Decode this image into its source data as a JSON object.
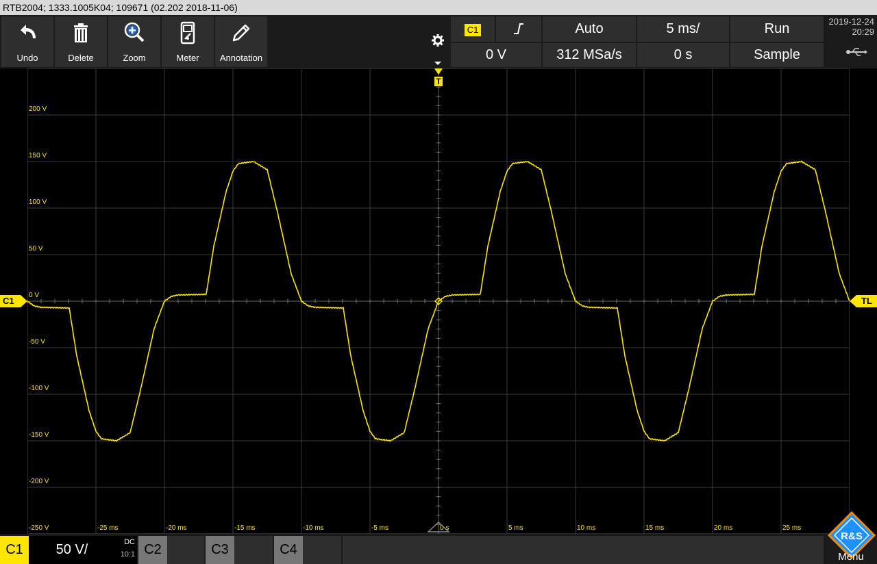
{
  "title_bar": "RTB2004; 1333.1005K04; 109671 (02.202 2018-11-06)",
  "toolbar": {
    "items": [
      {
        "label": "Undo",
        "icon": "undo-icon"
      },
      {
        "label": "Delete",
        "icon": "trash-icon"
      },
      {
        "label": "Zoom",
        "icon": "zoom-in-icon"
      },
      {
        "label": "Meter",
        "icon": "meter-icon"
      },
      {
        "label": "Annotation",
        "icon": "pencil-icon"
      }
    ]
  },
  "trigger_panel": {
    "source": "C1",
    "slope_icon": "rising-edge-icon",
    "mode": "Auto",
    "timebase": "5 ms/",
    "run_state": "Run",
    "level": "0 V",
    "sample_rate": "312 MSa/s",
    "position": "0 s",
    "acquisition": "Sample"
  },
  "datetime": {
    "date": "2019-12-24",
    "time": "20:29"
  },
  "waveform": {
    "y_labels": [
      "200 V",
      "150 V",
      "100 V",
      "50 V",
      "0 V",
      "-50 V",
      "-100 V",
      "-150 V",
      "-200 V",
      "-250 V"
    ],
    "x_labels": [
      "-25 ms",
      "-20 ms",
      "-15 ms",
      "-10 ms",
      "-5 ms",
      "0 s",
      "5 ms",
      "10 ms",
      "15 ms",
      "20 ms",
      "25 ms"
    ],
    "channel_marker": "C1",
    "trigger_marker": "T",
    "trigger_level_marker": "TL",
    "trace_color": "#ffe600"
  },
  "channels": {
    "c1": {
      "name": "C1",
      "scale": "50 V/",
      "coupling": "DC",
      "probe": "10:1"
    },
    "c2": {
      "name": "C2"
    },
    "c3": {
      "name": "C3"
    },
    "c4": {
      "name": "C4"
    }
  },
  "logo": {
    "text": "R&S"
  },
  "menu_label": "Menu"
}
